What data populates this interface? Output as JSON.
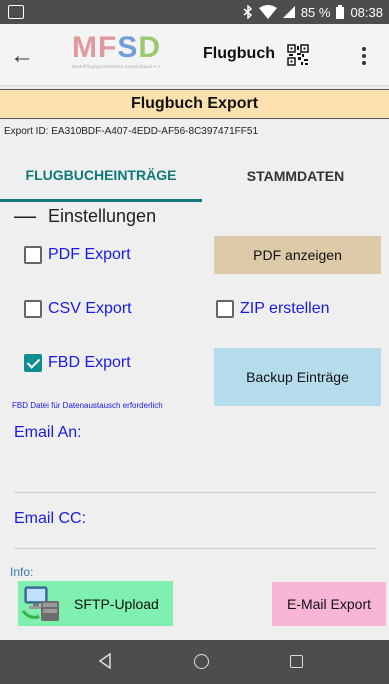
{
  "status_bar": {
    "battery": "85 %",
    "time": "08:38",
    "icons": [
      "image-icon",
      "bluetooth-icon",
      "wifi-icon",
      "signal-icon",
      "battery-icon"
    ]
  },
  "app_bar": {
    "logo_text": "MFSD",
    "logo_subtitle": "Modellflugsportverband Deutschland e.V.",
    "title": "Flugbuch",
    "icons": [
      "back-arrow-icon",
      "qr-code-icon",
      "more-vert-icon"
    ]
  },
  "page": {
    "title": "Flugbuch Export",
    "export_id": "Export ID: EA310BDF-A407-4EDD-AF56-8C397471FF51"
  },
  "tabs": [
    {
      "label": "FLUGBUCHEINTRÄGE",
      "active": true
    },
    {
      "label": "STAMMDATEN",
      "active": false
    }
  ],
  "settings": {
    "header": "Einstellungen",
    "pdf_export": {
      "label": "PDF Export",
      "checked": false
    },
    "pdf_show_button": "PDF anzeigen",
    "csv_export": {
      "label": "CSV Export",
      "checked": false
    },
    "zip_create": {
      "label": "ZIP erstellen",
      "checked": false
    },
    "fbd_export": {
      "label": "FBD Export",
      "checked": true
    },
    "backup_button": "Backup Einträge",
    "fbd_note": "FBD Datei für Datenaustausch erforderlich"
  },
  "email": {
    "to_label": "Email An:",
    "to_value": "",
    "cc_label": "Email CC:",
    "cc_value": ""
  },
  "info": {
    "label": "Info:",
    "sftp_button": "SFTP-Upload",
    "email_export_button": "E-Mail Export"
  },
  "colors": {
    "title_bar": "#fce0ad",
    "tab_accent": "#0e7a7a",
    "link_blue": "#1a1ae6",
    "pdf_button": "#dccaa8",
    "backup_button": "#b5dcea",
    "sftp_button": "#7ff0b0",
    "email_button": "#f9b5d6",
    "system_bars": "#4d4d4d"
  }
}
